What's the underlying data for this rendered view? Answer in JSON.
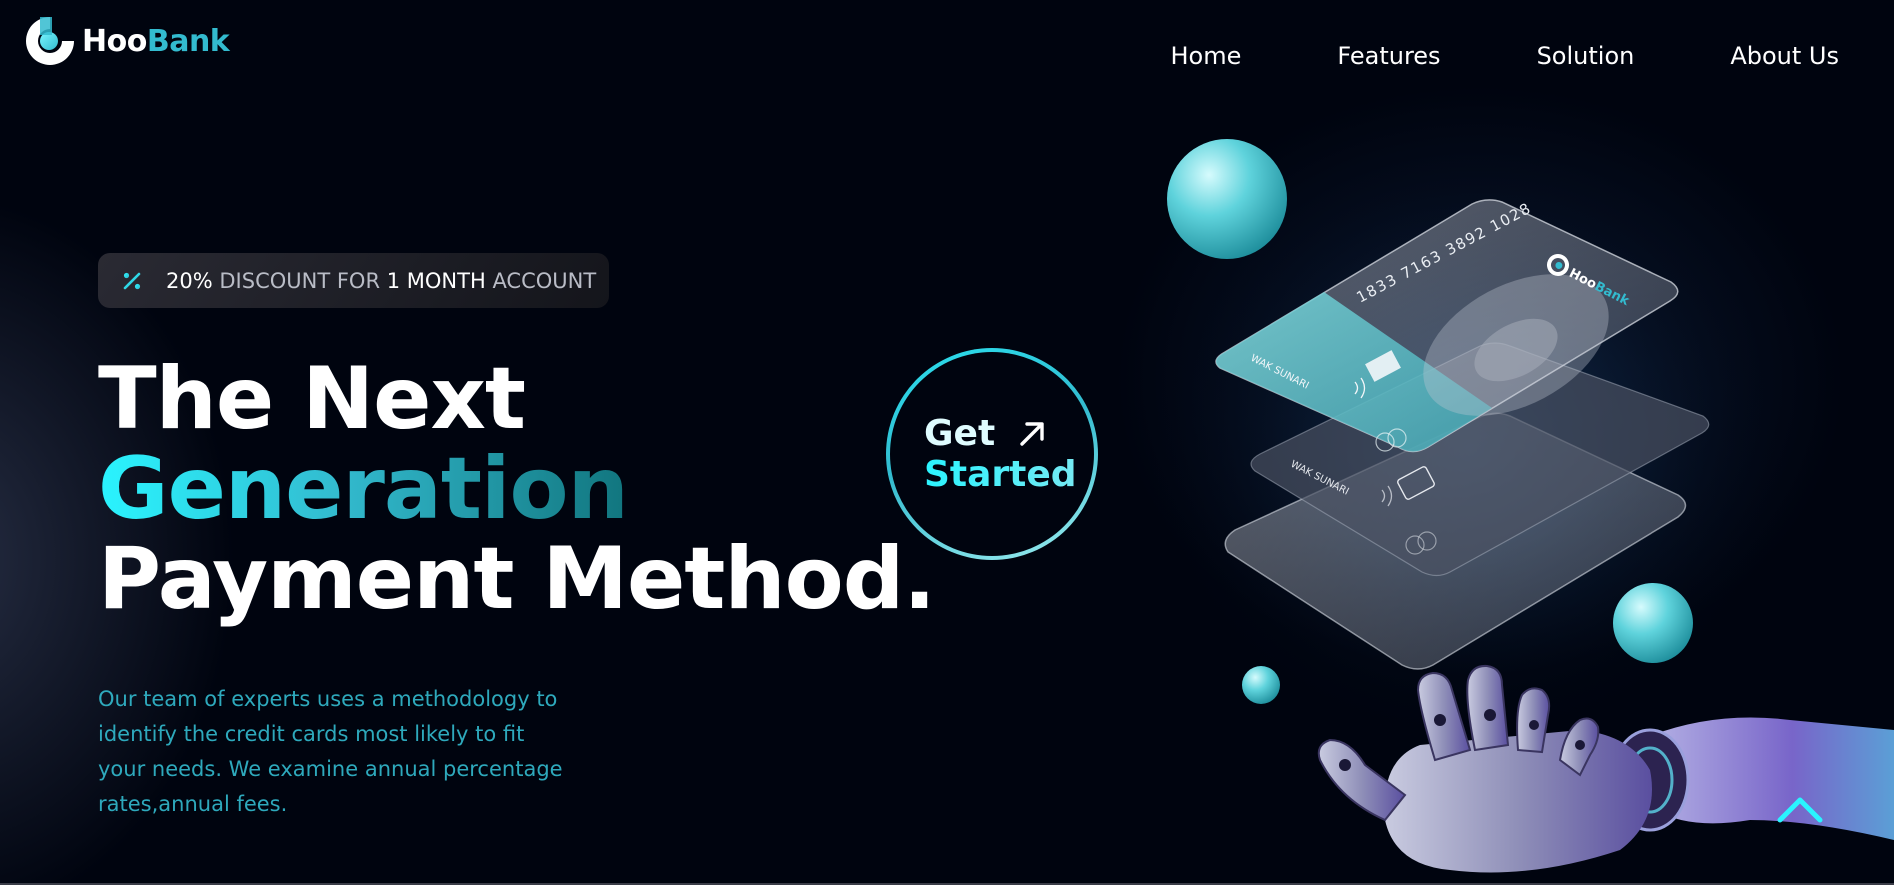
{
  "brand": {
    "name_part1": "Hoo",
    "name_part2": "Bank",
    "accent": "#33bbcf",
    "background": "#00040f"
  },
  "nav": {
    "items": [
      {
        "label": "Home"
      },
      {
        "label": "Features"
      },
      {
        "label": "Solution"
      },
      {
        "label": "About Us"
      }
    ]
  },
  "badge": {
    "icon": "discount-icon",
    "percent": "20%",
    "text1": "DISCOUNT FOR",
    "highlight": "1 MONTH",
    "text2": "ACCOUNT"
  },
  "hero": {
    "line1": "The Next",
    "line2": "Generation",
    "line3": "Payment Method.",
    "description": "Our team of experts uses a methodology to identify the credit cards most likely to fit your needs. We examine annual percentage rates,annual fees."
  },
  "cta": {
    "line1": "Get",
    "line2": "Started",
    "icon": "arrow-up-right-icon"
  },
  "card": {
    "number": "1833 7163 3892 1028",
    "holder": "WAK SUNARI",
    "brand_part1": "Hoo",
    "brand_part2": "Bank"
  },
  "scroll_top": {
    "icon": "chevron-up-icon"
  }
}
